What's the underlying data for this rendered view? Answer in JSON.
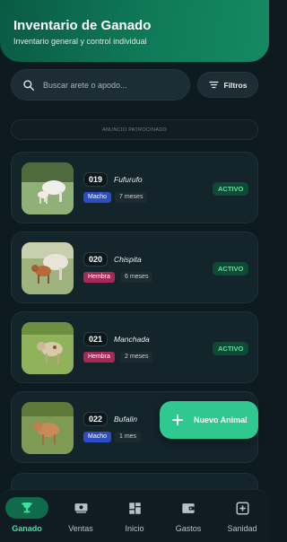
{
  "header": {
    "title": "Inventario de Ganado",
    "subtitle": "Inventario general y control individual"
  },
  "search": {
    "placeholder": "Buscar arete o apodo..."
  },
  "filters": {
    "label": "Filtros"
  },
  "ad": {
    "label": "ANUNCIO PATROCINADO"
  },
  "animals": [
    {
      "tag": "019",
      "name": "Fufurufo",
      "sex": "Macho",
      "age": "7 meses",
      "status": "ACTIVO"
    },
    {
      "tag": "020",
      "name": "Chispita",
      "sex": "Hembra",
      "age": "6 meses",
      "status": "ACTIVO"
    },
    {
      "tag": "021",
      "name": "Manchada",
      "sex": "Hembra",
      "age": "2 meses",
      "status": "ACTIVO"
    },
    {
      "tag": "022",
      "name": "Bufalin",
      "sex": "Macho",
      "age": "1 mes"
    }
  ],
  "fab": {
    "label": "Nuevo Animal"
  },
  "nav": {
    "items": [
      {
        "label": "Ganado",
        "icon": "trophy-icon",
        "active": true
      },
      {
        "label": "Ventas",
        "icon": "cash-icon"
      },
      {
        "label": "Inicio",
        "icon": "dashboard-icon"
      },
      {
        "label": "Gastos",
        "icon": "wallet-icon"
      },
      {
        "label": "Sanidad",
        "icon": "medical-plus-icon"
      }
    ]
  },
  "colors": {
    "accent": "#2ec890",
    "background": "#0d1b20",
    "male": "#2b4ec4",
    "female": "#a8285a",
    "status": "#5fe0a4"
  }
}
